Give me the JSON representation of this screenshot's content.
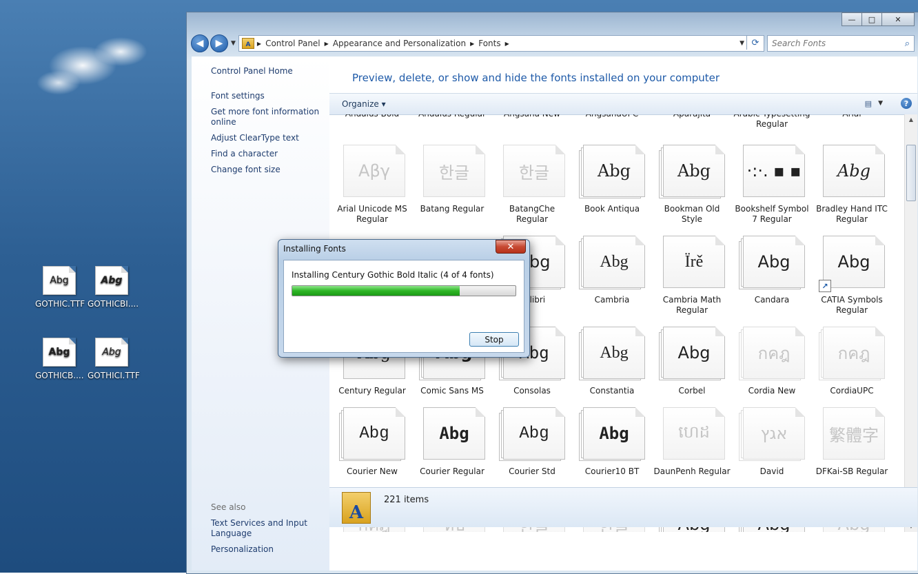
{
  "desktop": {
    "icons": [
      {
        "label": "GOTHIC.TTF",
        "preview": "Abg",
        "bold": false
      },
      {
        "label": "GOTHICBI....",
        "preview": "Abg",
        "bold": true
      },
      {
        "label": "GOTHICB....",
        "preview": "Abg",
        "bold": true
      },
      {
        "label": "GOTHICI.TTF",
        "preview": "Abg",
        "bold": false
      }
    ]
  },
  "window": {
    "controls": {
      "minimize": "—",
      "maximize": "□",
      "close": "✕"
    },
    "breadcrumb": [
      "Control Panel",
      "Appearance and Personalization",
      "Fonts"
    ],
    "search_placeholder": "Search Fonts",
    "left_pane": {
      "home": "Control Panel Home",
      "links": [
        "Font settings",
        "Get more font information online",
        "Adjust ClearType text",
        "Find a character",
        "Change font size"
      ],
      "see_also_title": "See also",
      "see_also": [
        "Text Services and Input Language",
        "Personalization"
      ]
    },
    "headline": "Preview, delete, or show and hide the fonts installed on your computer",
    "toolbar": {
      "organize": "Organize",
      "help": "?"
    },
    "partial_top_row": [
      "Andalus Bold",
      "Andalus Regular",
      "Angsana New",
      "AngsanaUPC",
      "Aparajita",
      "Arabic Typesetting Regular",
      "Arial"
    ],
    "fonts_rows": [
      [
        {
          "name": "Arial Unicode MS Regular",
          "preview": "Aβγ",
          "faded": true,
          "stack": false
        },
        {
          "name": "Batang Regular",
          "preview": "한글",
          "faded": true,
          "stack": false
        },
        {
          "name": "BatangChe Regular",
          "preview": "한글",
          "faded": true,
          "stack": false
        },
        {
          "name": "Book Antiqua",
          "preview": "Abg",
          "faded": false,
          "stack": true
        },
        {
          "name": "Bookman Old Style",
          "preview": "Abg",
          "faded": false,
          "stack": true
        },
        {
          "name": "Bookshelf Symbol 7 Regular",
          "preview": "·:·. ▪ ▪",
          "faded": false,
          "stack": false
        },
        {
          "name": "Bradley Hand ITC Regular",
          "preview": "Abg",
          "faded": false,
          "stack": false
        }
      ],
      [
        {
          "name": "",
          "preview": "",
          "faded": false,
          "stack": false,
          "hidden": true
        },
        {
          "name": "",
          "preview": "",
          "faded": false,
          "stack": false,
          "hidden": true
        },
        {
          "name": "Calibri",
          "preview": "Abg",
          "faded": false,
          "stack": true
        },
        {
          "name": "Cambria",
          "preview": "Abg",
          "faded": false,
          "stack": true
        },
        {
          "name": "Cambria Math Regular",
          "preview": "Ïrě",
          "faded": false,
          "stack": false
        },
        {
          "name": "Candara",
          "preview": "Abg",
          "faded": false,
          "stack": true
        },
        {
          "name": "CATIA Symbols Regular",
          "preview": "Abg",
          "faded": false,
          "stack": false,
          "shortcut": true
        }
      ],
      [
        {
          "name": "Century Regular",
          "preview": "Abg",
          "faded": false,
          "stack": false
        },
        {
          "name": "Comic Sans MS",
          "preview": "Abg",
          "faded": false,
          "stack": true
        },
        {
          "name": "Consolas",
          "preview": "Abg",
          "faded": false,
          "stack": true
        },
        {
          "name": "Constantia",
          "preview": "Abg",
          "faded": false,
          "stack": true
        },
        {
          "name": "Corbel",
          "preview": "Abg",
          "faded": false,
          "stack": true
        },
        {
          "name": "Cordia New",
          "preview": "กคฎ",
          "faded": true,
          "stack": true
        },
        {
          "name": "CordiaUPC",
          "preview": "กคฎ",
          "faded": true,
          "stack": true
        }
      ],
      [
        {
          "name": "Courier New",
          "preview": "Abg",
          "faded": false,
          "stack": true
        },
        {
          "name": "Courier Regular",
          "preview": "Abg",
          "faded": false,
          "stack": false
        },
        {
          "name": "Courier Std",
          "preview": "Abg",
          "faded": false,
          "stack": true
        },
        {
          "name": "Courier10 BT",
          "preview": "Abg",
          "faded": false,
          "stack": true
        },
        {
          "name": "DaunPenh Regular",
          "preview": "ហេដ",
          "faded": true,
          "stack": false
        },
        {
          "name": "David",
          "preview": "אגץ",
          "faded": true,
          "stack": true
        },
        {
          "name": "DFKai-SB Regular",
          "preview": "繁體字",
          "faded": true,
          "stack": false
        }
      ],
      [
        {
          "name": "",
          "preview": "กคฎ",
          "faded": true,
          "stack": false
        },
        {
          "name": "",
          "preview": "ห่ป",
          "faded": true,
          "stack": false
        },
        {
          "name": "",
          "preview": "한글",
          "faded": true,
          "stack": false
        },
        {
          "name": "",
          "preview": "한글",
          "faded": true,
          "stack": false
        },
        {
          "name": "",
          "preview": "Abg",
          "faded": false,
          "stack": true
        },
        {
          "name": "",
          "preview": "Abg",
          "faded": false,
          "stack": true
        },
        {
          "name": "",
          "preview": "Abg",
          "faded": true,
          "stack": false
        }
      ]
    ],
    "status": {
      "count": "221 items"
    }
  },
  "dialog": {
    "title": "Installing Fonts",
    "close": "✕",
    "message": "Installing Century Gothic Bold Italic (4 of 4 fonts)",
    "progress": 0.75,
    "stop_label": "Stop"
  }
}
